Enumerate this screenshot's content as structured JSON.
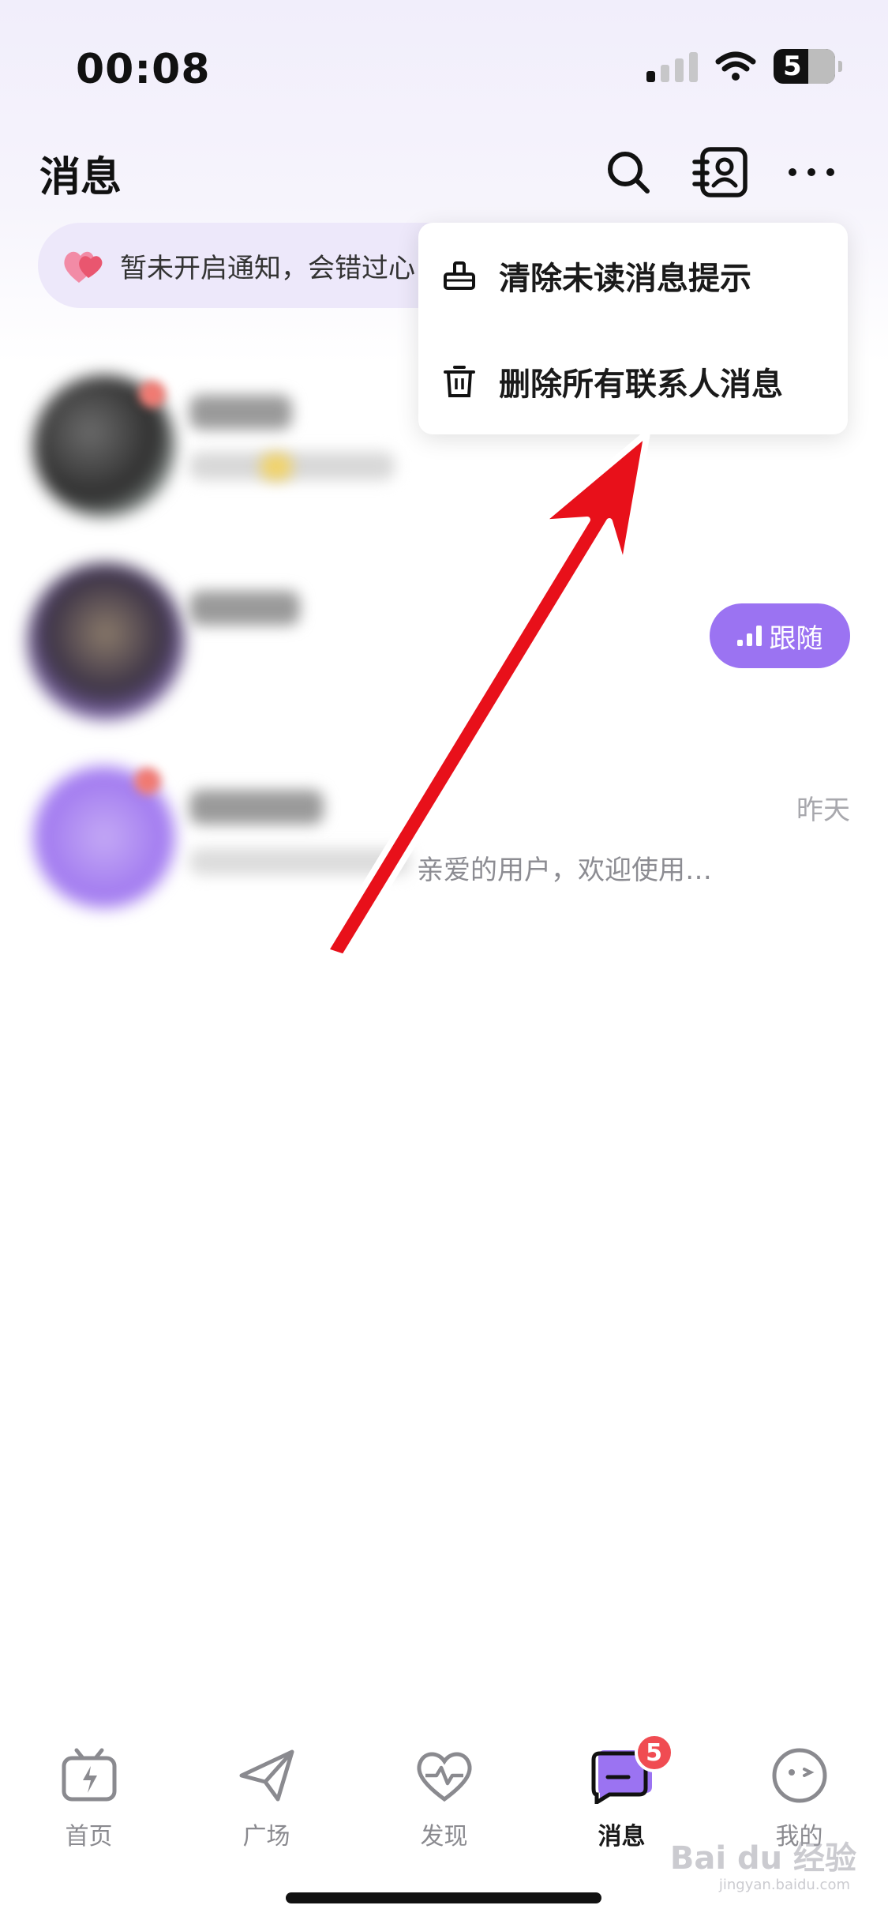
{
  "status_bar": {
    "time": "00:08",
    "battery": "5"
  },
  "header": {
    "title": "消息"
  },
  "notice": {
    "text": "暂未开启通知，会错过心"
  },
  "dropdown": {
    "items": [
      {
        "label": "清除未读消息提示",
        "icon": "clear-icon"
      },
      {
        "label": "删除所有联系人消息",
        "icon": "trash-icon"
      }
    ]
  },
  "conversations": [
    {
      "follow_label": ""
    },
    {
      "follow_label": "跟随"
    },
    {
      "time": "昨天",
      "preview": "亲爱的用户，欢迎使用…"
    }
  ],
  "tabbar": {
    "tabs": [
      {
        "label": "首页",
        "icon": "tv-icon"
      },
      {
        "label": "广场",
        "icon": "paper-plane-icon"
      },
      {
        "label": "发现",
        "icon": "heart-pulse-icon"
      },
      {
        "label": "消息",
        "icon": "message-icon",
        "badge": "5",
        "active": true
      },
      {
        "label": "我的",
        "icon": "face-icon"
      }
    ]
  },
  "watermark": {
    "brand": "Bai du 经验",
    "url": "jingyan.baidu.com"
  },
  "colors": {
    "accent": "#9b73f2",
    "badge": "#f04c52",
    "annotation_arrow": "#e8101a"
  }
}
